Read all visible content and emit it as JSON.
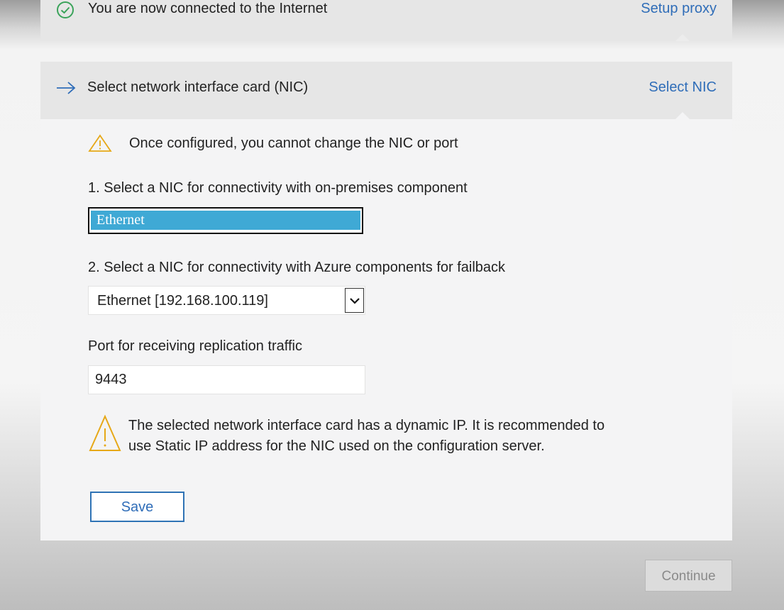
{
  "internet_step": {
    "status_text": "You are now connected to the Internet",
    "action_link": "Setup proxy",
    "icon": "check-circle-icon",
    "icon_color": "#3aa35a"
  },
  "nic_step": {
    "title": "Select network interface card (NIC)",
    "action_link": "Select NIC",
    "icon": "arrow-right-icon",
    "icon_color": "#2f6db8"
  },
  "nic_config": {
    "warning_top": "Once configured, you cannot change the NIC or port",
    "onprem_label": "1. Select a NIC for connectivity with on-premises component",
    "onprem_selected": "Ethernet",
    "failback_label": "2. Select a NIC for connectivity with Azure components for failback",
    "failback_selected": "Ethernet [192.168.100.119]",
    "port_label": "Port for receiving replication traffic",
    "port_value": "9443",
    "warning_line1": "The selected network interface card has a dynamic IP. It is recommended to",
    "warning_line2": "use Static IP address for the NIC used on the configuration server.",
    "warning_color": "#e6a817",
    "save_label": "Save"
  },
  "footer": {
    "continue_label": "Continue"
  }
}
